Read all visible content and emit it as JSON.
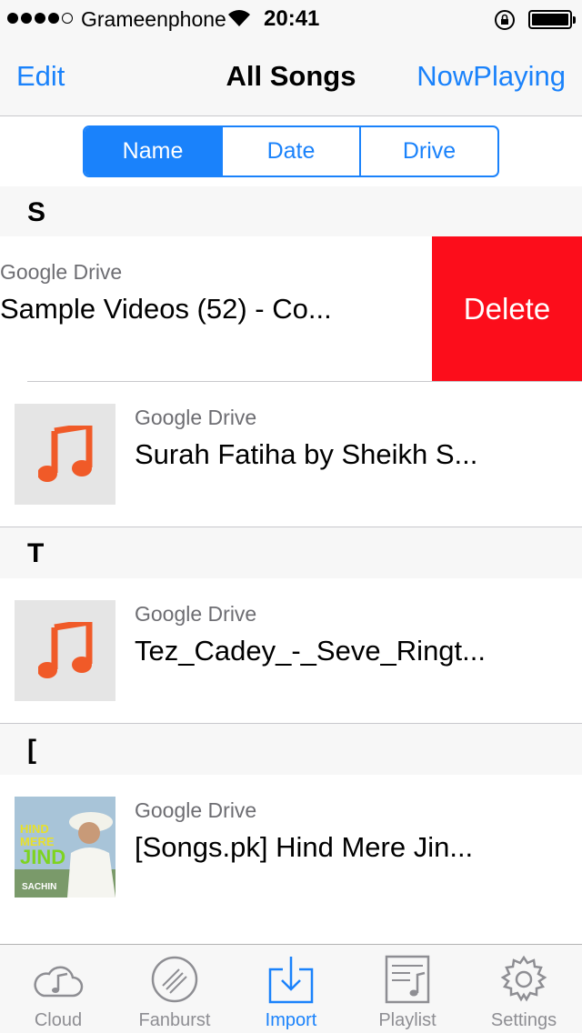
{
  "status_bar": {
    "carrier": "Grameenphone",
    "time": "20:41"
  },
  "nav": {
    "edit_label": "Edit",
    "title": "All Songs",
    "now_playing_label": "NowPlaying"
  },
  "segments": [
    {
      "label": "Name",
      "active": true
    },
    {
      "label": "Date",
      "active": false
    },
    {
      "label": "Drive",
      "active": false
    }
  ],
  "sections": [
    {
      "letter": "S"
    },
    {
      "letter": "T"
    },
    {
      "letter": "["
    }
  ],
  "songs": [
    {
      "source": "Google Drive",
      "title": "Sample Videos (52) - Co...",
      "swiped": true
    },
    {
      "source": "Google Drive",
      "title": "Surah Fatiha by Sheikh S...",
      "thumb": "music-note-icon"
    },
    {
      "source": "Google Drive",
      "title": "Tez_Cadey_-_Seve_Ringt...",
      "thumb": "music-note-icon"
    },
    {
      "source": "Google Drive",
      "title": "[Songs.pk] Hind Mere Jin...",
      "thumb": "album-art"
    }
  ],
  "album_art": {
    "line1": "HIND",
    "line2": "MERE",
    "line3": "JIND",
    "credit": "SACHIN"
  },
  "delete_label": "Delete",
  "tabs": [
    {
      "label": "Cloud",
      "icon": "cloud-music-icon"
    },
    {
      "label": "Fanburst",
      "icon": "fanburst-icon"
    },
    {
      "label": "Import",
      "icon": "import-icon",
      "active": true
    },
    {
      "label": "Playlist",
      "icon": "playlist-icon"
    },
    {
      "label": "Settings",
      "icon": "gear-icon"
    }
  ],
  "colors": {
    "accent": "#1a82fb",
    "delete": "#fc0d1b",
    "music_icon": "#f05a28"
  }
}
